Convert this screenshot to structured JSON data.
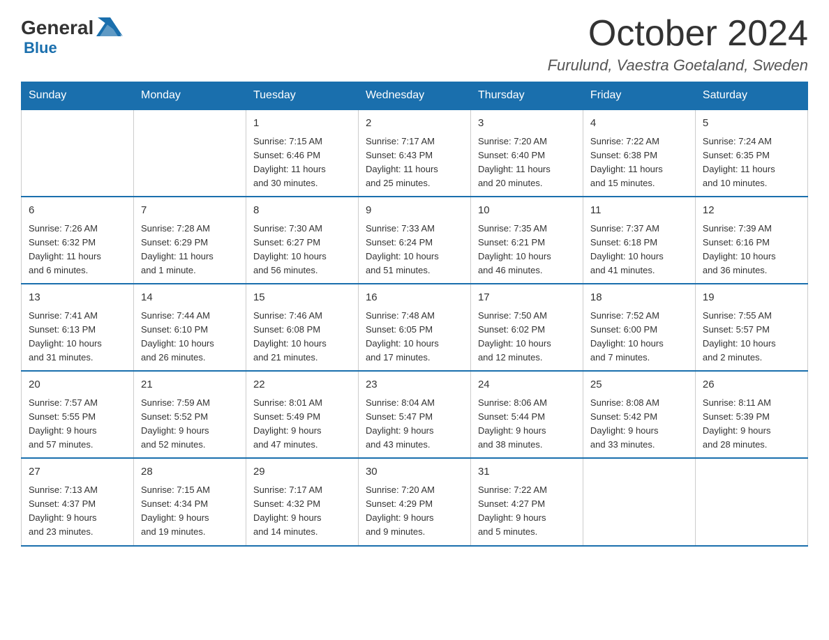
{
  "header": {
    "logo_general": "General",
    "logo_blue": "Blue",
    "month_year": "October 2024",
    "location": "Furulund, Vaestra Goetaland, Sweden"
  },
  "calendar": {
    "days_of_week": [
      "Sunday",
      "Monday",
      "Tuesday",
      "Wednesday",
      "Thursday",
      "Friday",
      "Saturday"
    ],
    "weeks": [
      [
        {
          "day": "",
          "info": ""
        },
        {
          "day": "",
          "info": ""
        },
        {
          "day": "1",
          "info": "Sunrise: 7:15 AM\nSunset: 6:46 PM\nDaylight: 11 hours\nand 30 minutes."
        },
        {
          "day": "2",
          "info": "Sunrise: 7:17 AM\nSunset: 6:43 PM\nDaylight: 11 hours\nand 25 minutes."
        },
        {
          "day": "3",
          "info": "Sunrise: 7:20 AM\nSunset: 6:40 PM\nDaylight: 11 hours\nand 20 minutes."
        },
        {
          "day": "4",
          "info": "Sunrise: 7:22 AM\nSunset: 6:38 PM\nDaylight: 11 hours\nand 15 minutes."
        },
        {
          "day": "5",
          "info": "Sunrise: 7:24 AM\nSunset: 6:35 PM\nDaylight: 11 hours\nand 10 minutes."
        }
      ],
      [
        {
          "day": "6",
          "info": "Sunrise: 7:26 AM\nSunset: 6:32 PM\nDaylight: 11 hours\nand 6 minutes."
        },
        {
          "day": "7",
          "info": "Sunrise: 7:28 AM\nSunset: 6:29 PM\nDaylight: 11 hours\nand 1 minute."
        },
        {
          "day": "8",
          "info": "Sunrise: 7:30 AM\nSunset: 6:27 PM\nDaylight: 10 hours\nand 56 minutes."
        },
        {
          "day": "9",
          "info": "Sunrise: 7:33 AM\nSunset: 6:24 PM\nDaylight: 10 hours\nand 51 minutes."
        },
        {
          "day": "10",
          "info": "Sunrise: 7:35 AM\nSunset: 6:21 PM\nDaylight: 10 hours\nand 46 minutes."
        },
        {
          "day": "11",
          "info": "Sunrise: 7:37 AM\nSunset: 6:18 PM\nDaylight: 10 hours\nand 41 minutes."
        },
        {
          "day": "12",
          "info": "Sunrise: 7:39 AM\nSunset: 6:16 PM\nDaylight: 10 hours\nand 36 minutes."
        }
      ],
      [
        {
          "day": "13",
          "info": "Sunrise: 7:41 AM\nSunset: 6:13 PM\nDaylight: 10 hours\nand 31 minutes."
        },
        {
          "day": "14",
          "info": "Sunrise: 7:44 AM\nSunset: 6:10 PM\nDaylight: 10 hours\nand 26 minutes."
        },
        {
          "day": "15",
          "info": "Sunrise: 7:46 AM\nSunset: 6:08 PM\nDaylight: 10 hours\nand 21 minutes."
        },
        {
          "day": "16",
          "info": "Sunrise: 7:48 AM\nSunset: 6:05 PM\nDaylight: 10 hours\nand 17 minutes."
        },
        {
          "day": "17",
          "info": "Sunrise: 7:50 AM\nSunset: 6:02 PM\nDaylight: 10 hours\nand 12 minutes."
        },
        {
          "day": "18",
          "info": "Sunrise: 7:52 AM\nSunset: 6:00 PM\nDaylight: 10 hours\nand 7 minutes."
        },
        {
          "day": "19",
          "info": "Sunrise: 7:55 AM\nSunset: 5:57 PM\nDaylight: 10 hours\nand 2 minutes."
        }
      ],
      [
        {
          "day": "20",
          "info": "Sunrise: 7:57 AM\nSunset: 5:55 PM\nDaylight: 9 hours\nand 57 minutes."
        },
        {
          "day": "21",
          "info": "Sunrise: 7:59 AM\nSunset: 5:52 PM\nDaylight: 9 hours\nand 52 minutes."
        },
        {
          "day": "22",
          "info": "Sunrise: 8:01 AM\nSunset: 5:49 PM\nDaylight: 9 hours\nand 47 minutes."
        },
        {
          "day": "23",
          "info": "Sunrise: 8:04 AM\nSunset: 5:47 PM\nDaylight: 9 hours\nand 43 minutes."
        },
        {
          "day": "24",
          "info": "Sunrise: 8:06 AM\nSunset: 5:44 PM\nDaylight: 9 hours\nand 38 minutes."
        },
        {
          "day": "25",
          "info": "Sunrise: 8:08 AM\nSunset: 5:42 PM\nDaylight: 9 hours\nand 33 minutes."
        },
        {
          "day": "26",
          "info": "Sunrise: 8:11 AM\nSunset: 5:39 PM\nDaylight: 9 hours\nand 28 minutes."
        }
      ],
      [
        {
          "day": "27",
          "info": "Sunrise: 7:13 AM\nSunset: 4:37 PM\nDaylight: 9 hours\nand 23 minutes."
        },
        {
          "day": "28",
          "info": "Sunrise: 7:15 AM\nSunset: 4:34 PM\nDaylight: 9 hours\nand 19 minutes."
        },
        {
          "day": "29",
          "info": "Sunrise: 7:17 AM\nSunset: 4:32 PM\nDaylight: 9 hours\nand 14 minutes."
        },
        {
          "day": "30",
          "info": "Sunrise: 7:20 AM\nSunset: 4:29 PM\nDaylight: 9 hours\nand 9 minutes."
        },
        {
          "day": "31",
          "info": "Sunrise: 7:22 AM\nSunset: 4:27 PM\nDaylight: 9 hours\nand 5 minutes."
        },
        {
          "day": "",
          "info": ""
        },
        {
          "day": "",
          "info": ""
        }
      ]
    ]
  }
}
